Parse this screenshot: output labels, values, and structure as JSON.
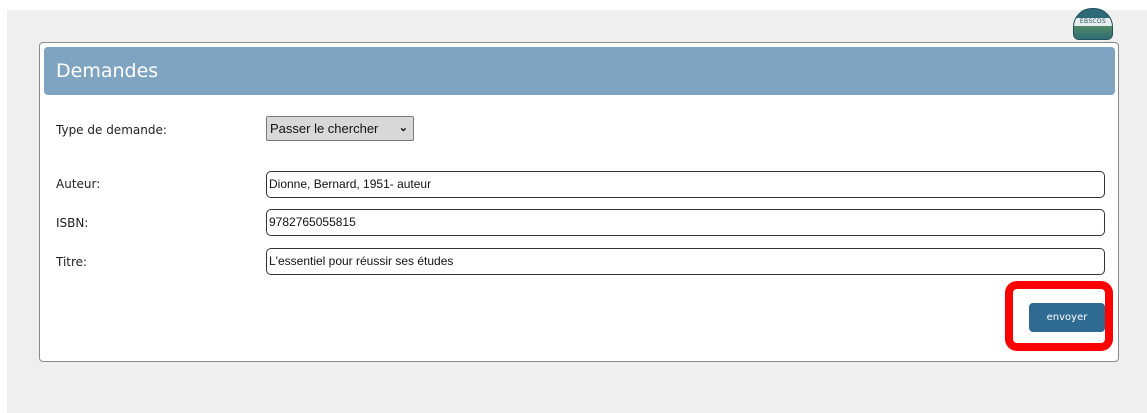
{
  "logo": {
    "name": "logo-icon",
    "text": "EBSCOS"
  },
  "panel": {
    "title": "Demandes"
  },
  "form": {
    "request_type": {
      "label": "Type de demande:",
      "selected": "Passer le chercher"
    },
    "fields": [
      {
        "label": "Auteur:",
        "value": "Dionne, Bernard, 1951- auteur"
      },
      {
        "label": "ISBN:",
        "value": "9782765055815"
      },
      {
        "label": "Titre:",
        "value": "L'essentiel pour réussir ses études"
      }
    ],
    "submit_label": "envoyer"
  },
  "colors": {
    "header": "#7ea4c2",
    "button": "#2f6a93",
    "highlight": "#ff0000",
    "background": "#efefef"
  }
}
